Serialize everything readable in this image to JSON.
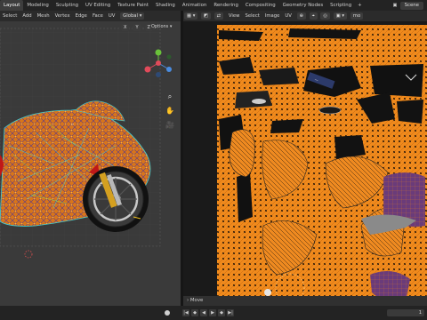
{
  "topbar": {
    "workspaces": [
      "Layout",
      "Modeling",
      "Sculpting",
      "UV Editing",
      "Texture Paint",
      "Shading",
      "Animation",
      "Rendering",
      "Compositing",
      "Geometry Nodes",
      "Scripting"
    ],
    "active_workspace": "Layout",
    "add_symbol": "+",
    "scene_name": "Scene"
  },
  "viewport_header": {
    "menus": [
      "Select",
      "Add",
      "Mesh",
      "Vertex",
      "Edge",
      "Face",
      "UV"
    ],
    "orientation": "Global",
    "axes": [
      "X",
      "Y",
      "Z"
    ],
    "options_label": "Options"
  },
  "uv_header": {
    "menus": [
      "View",
      "Select",
      "Image",
      "UV"
    ],
    "image_name": "mo"
  },
  "gizmo": {
    "x": "X",
    "y": "Y",
    "z": "Z"
  },
  "status": {
    "move_label": "Move"
  },
  "timeline": {
    "frame": "1"
  },
  "colors": {
    "mesh_orange": "#f08a1c",
    "uv_black": "#121212",
    "selection_cyan": "#3fd0d6",
    "purple_patch": "#6a3b7a"
  }
}
